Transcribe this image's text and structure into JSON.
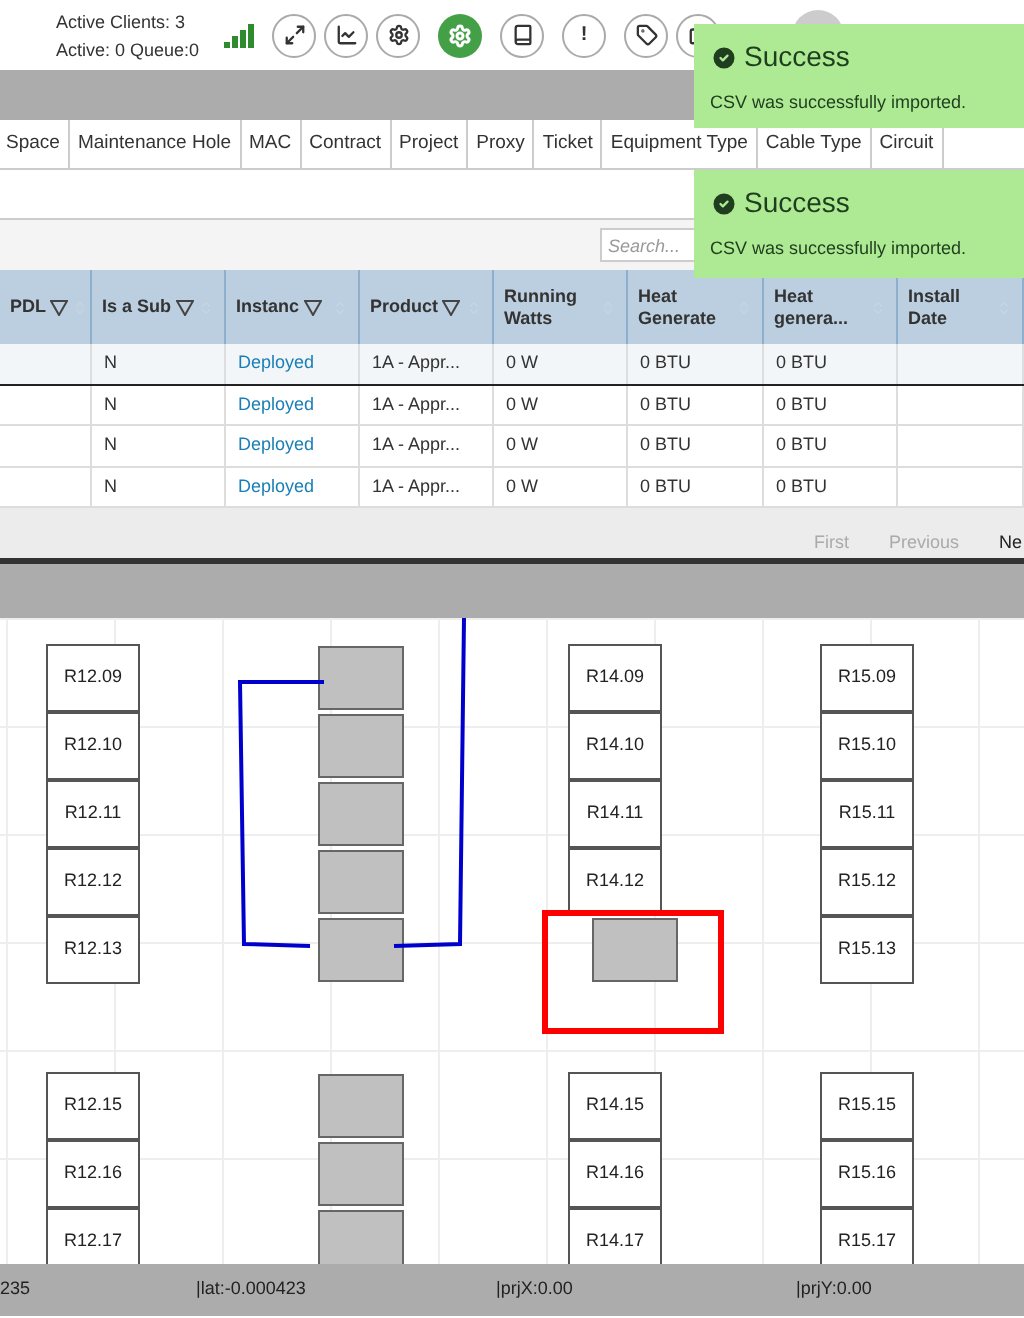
{
  "header": {
    "clients": "Active Clients: 3",
    "queue": "Active: 0 Queue:0",
    "toolbar": [
      {
        "kind": "expand"
      },
      {
        "kind": "chart"
      },
      {
        "kind": "gear"
      },
      {
        "kind": "gear-green"
      },
      {
        "kind": "book"
      },
      {
        "kind": "text",
        "label": "!"
      },
      {
        "kind": "tag"
      },
      {
        "kind": "external"
      }
    ]
  },
  "tabs": [
    {
      "label": "Space",
      "selected": false
    },
    {
      "label": "Maintenance Hole",
      "selected": false
    },
    {
      "label": "MAC",
      "selected": false
    },
    {
      "label": "Contract",
      "selected": false
    },
    {
      "label": "Project",
      "selected": false
    },
    {
      "label": "Proxy",
      "selected": false
    },
    {
      "label": "Ticket",
      "selected": false
    },
    {
      "label": "Equipment Type",
      "selected": false
    },
    {
      "label": "Cable Type",
      "selected": false
    },
    {
      "label": "Circuit",
      "selected": false
    }
  ],
  "search": {
    "placeholder": "Search..."
  },
  "table": {
    "columns": [
      {
        "label": "PDL",
        "filter": true
      },
      {
        "label": "Is a Sub",
        "filter": true
      },
      {
        "label": "Instanc",
        "filter": true
      },
      {
        "label": "Product",
        "filter": true
      },
      {
        "label": "Running Watts",
        "filter": false
      },
      {
        "label": "Heat Generate",
        "filter": false
      },
      {
        "label": "Heat genera...",
        "filter": false
      },
      {
        "label": "Install Date",
        "filter": false
      }
    ],
    "rows": [
      {
        "selected": true,
        "cells": [
          "",
          "N",
          "Deployed",
          "1A - Appr...",
          "0 W",
          "0 BTU",
          "0 BTU",
          ""
        ]
      },
      {
        "selected": false,
        "cells": [
          "",
          "N",
          "Deployed",
          "1A - Appr...",
          "0 W",
          "0 BTU",
          "0 BTU",
          ""
        ]
      },
      {
        "selected": false,
        "cells": [
          "",
          "N",
          "Deployed",
          "1A - Appr...",
          "0 W",
          "0 BTU",
          "0 BTU",
          ""
        ]
      },
      {
        "selected": false,
        "cells": [
          "",
          "N",
          "Deployed",
          "1A - Appr...",
          "0 W",
          "0 BTU",
          "0 BTU",
          ""
        ]
      }
    ]
  },
  "pagination": [
    "First",
    "Previous",
    "Ne"
  ],
  "map": {
    "groups": [
      {
        "columns": [
          [
            {
              "kind": "slot",
              "label": "R12.09",
              "selected": false
            },
            {
              "kind": "slot",
              "label": "R12.10",
              "selected": false
            },
            {
              "kind": "slot",
              "label": "R12.11",
              "selected": false
            },
            {
              "kind": "slot",
              "label": "R12.12",
              "selected": false
            },
            {
              "kind": "slot",
              "label": "R12.13",
              "selected": false
            }
          ],
          [
            {
              "kind": "device",
              "selected": false
            },
            {
              "kind": "device",
              "selected": false
            },
            {
              "kind": "device",
              "selected": false
            },
            {
              "kind": "device",
              "selected": false
            },
            {
              "kind": "device",
              "selected": false
            }
          ],
          [
            {
              "kind": "slot",
              "label": "R14.09",
              "selected": false
            },
            {
              "kind": "slot",
              "label": "R14.10",
              "selected": false
            },
            {
              "kind": "slot",
              "label": "R14.11",
              "selected": false
            },
            {
              "kind": "slot",
              "label": "R14.12",
              "selected": false
            },
            {
              "kind": "device",
              "selected": true
            }
          ],
          [
            {
              "kind": "slot",
              "label": "R15.09",
              "selected": false
            },
            {
              "kind": "slot",
              "label": "R15.10",
              "selected": false
            },
            {
              "kind": "slot",
              "label": "R15.11",
              "selected": false
            },
            {
              "kind": "slot",
              "label": "R15.12",
              "selected": false
            },
            {
              "kind": "slot",
              "label": "R15.13",
              "selected": false
            }
          ]
        ]
      },
      {
        "columns": [
          [
            {
              "kind": "slot",
              "label": "R12.15",
              "selected": false
            },
            {
              "kind": "slot",
              "label": "R12.16",
              "selected": false
            },
            {
              "kind": "slot",
              "label": "R12.17",
              "selected": false
            }
          ],
          [
            {
              "kind": "device",
              "selected": false
            },
            {
              "kind": "device",
              "selected": false
            },
            {
              "kind": "device",
              "selected": false
            }
          ],
          [
            {
              "kind": "slot",
              "label": "R14.15",
              "selected": false
            },
            {
              "kind": "slot",
              "label": "R14.16",
              "selected": false
            },
            {
              "kind": "slot",
              "label": "R14.17",
              "selected": false
            }
          ],
          [
            {
              "kind": "slot",
              "label": "R15.15",
              "selected": false
            },
            {
              "kind": "slot",
              "label": "R15.16",
              "selected": false
            },
            {
              "kind": "slot",
              "label": "R15.17",
              "selected": false
            }
          ]
        ]
      }
    ]
  },
  "status_bar": [
    "235",
    "|lat:-0.000423",
    "|prjX:0.00",
    "|prjY:0.00"
  ],
  "toasts": [
    {
      "title": "Success",
      "message": "CSV was successfully imported."
    },
    {
      "title": "Success",
      "message": "CSV was successfully imported."
    }
  ]
}
